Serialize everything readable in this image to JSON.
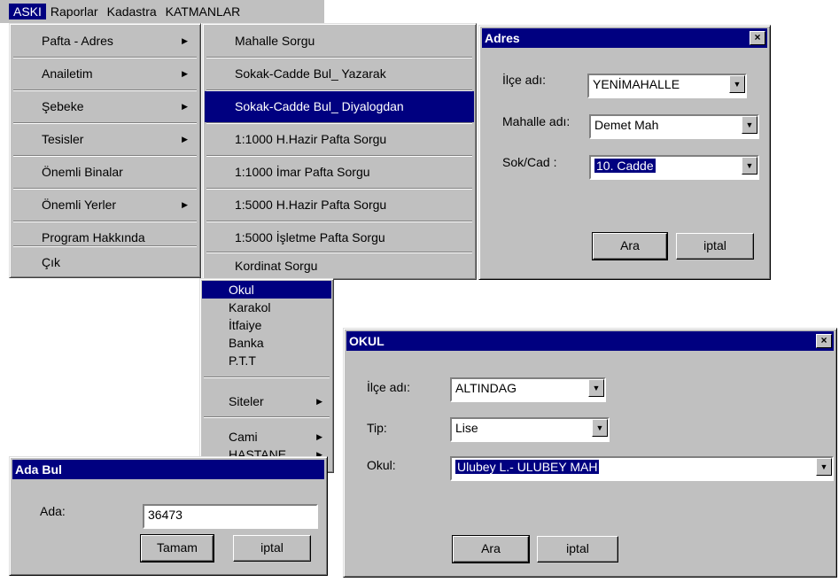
{
  "menubar": {
    "items": [
      "ASKI",
      "Raporlar",
      "Kadastra",
      "KATMANLAR"
    ]
  },
  "main_menu": {
    "items": [
      {
        "label": "Pafta - Adres",
        "has_submenu": true
      },
      {
        "label": "Anailetim",
        "has_submenu": true
      },
      {
        "label": "Şebeke",
        "has_submenu": true
      },
      {
        "label": "Tesisler",
        "has_submenu": true
      },
      {
        "label": "Önemli Binalar",
        "has_submenu": false
      },
      {
        "label": "Önemli Yerler",
        "has_submenu": true
      },
      {
        "label": "Program Hakkında",
        "has_submenu": false
      },
      {
        "label": "Çık",
        "has_submenu": false
      }
    ]
  },
  "pafta_menu": {
    "items": [
      "Mahalle Sorgu",
      "Sokak-Cadde Bul_ Yazarak",
      "Sokak-Cadde Bul_ Diyalogdan",
      "1:1000 H.Hazir Pafta Sorgu",
      "1:1000 İmar Pafta Sorgu",
      "1:5000 H.Hazir Pafta Sorgu",
      "1:5000 İşletme Pafta Sorgu",
      "Kordinat Sorgu"
    ],
    "selected_index": 2
  },
  "yerler_menu": {
    "items": [
      {
        "label": "Okul",
        "has_submenu": false
      },
      {
        "label": "Karakol",
        "has_submenu": false
      },
      {
        "label": "İtfaiye",
        "has_submenu": false
      },
      {
        "label": "Banka",
        "has_submenu": false
      },
      {
        "label": "P.T.T",
        "has_submenu": false
      },
      {
        "label": "Siteler",
        "has_submenu": true
      },
      {
        "label": "Cami",
        "has_submenu": true
      },
      {
        "label": "HASTANE",
        "has_submenu": true
      }
    ],
    "selected_index": 0
  },
  "adres_dialog": {
    "title": "Adres",
    "close": "×",
    "ilce_label": "İlçe adı:",
    "ilce_value": "YENİMAHALLE",
    "mahalle_label": "Mahalle adı:",
    "mahalle_value": "Demet Mah",
    "sokak_label": "Sok/Cad :",
    "sokak_value": "10. Cadde",
    "ara": "Ara",
    "iptal": "iptal"
  },
  "okul_dialog": {
    "title": "OKUL",
    "close": "×",
    "ilce_label": "İlçe adı:",
    "ilce_value": "ALTINDAG",
    "tip_label": "Tip:",
    "tip_value": "Lise",
    "okul_label": "Okul:",
    "okul_value": "Ulubey L.- ULUBEY MAH",
    "ara": "Ara",
    "iptal": "iptal"
  },
  "ada_dialog": {
    "title": "Ada Bul",
    "ada_label": "Ada:",
    "ada_value": "36473",
    "tamam": "Tamam",
    "iptal": "iptal"
  },
  "colors": {
    "titlebar": "#000080",
    "face": "#c0c0c0",
    "highlight": "#000080"
  }
}
